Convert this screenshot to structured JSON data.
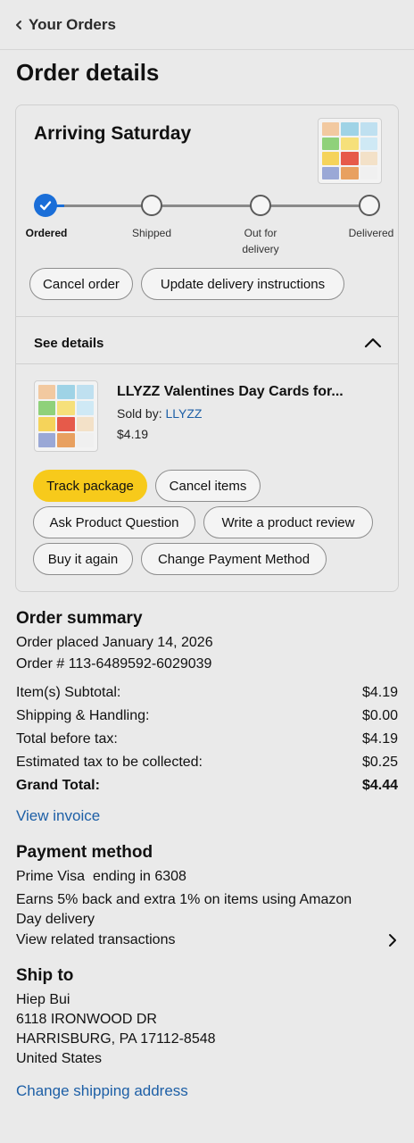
{
  "topbar": {
    "back_label": "Your Orders"
  },
  "page_title": "Order details",
  "shipment": {
    "arriving": "Arriving Saturday",
    "steps": [
      "Ordered",
      "Shipped",
      "Out for\ndelivery",
      "Delivered"
    ],
    "current_step": 0,
    "actions": {
      "cancel_order": "Cancel order",
      "update_instructions": "Update delivery instructions"
    },
    "see_details": "See details",
    "accent_color": "#1a6ed8"
  },
  "item": {
    "title": "LLYZZ Valentines Day Cards for...",
    "sold_by_label": "Sold by: ",
    "seller": "LLYZZ",
    "price": "$4.19",
    "buttons": {
      "track": "Track package",
      "cancel_items": "Cancel items",
      "ask_question": "Ask Product Question",
      "write_review": "Write a product review",
      "buy_again": "Buy it again",
      "change_payment": "Change Payment Method"
    },
    "track_color": "#f7ca1b"
  },
  "order_summary": {
    "heading": "Order summary",
    "placed": "Order placed January 14, 2026",
    "order_number": "Order # 113-6489592-6029039",
    "rows": [
      {
        "label": "Item(s) Subtotal:",
        "value": "$4.19"
      },
      {
        "label": "Shipping & Handling:",
        "value": "$0.00"
      },
      {
        "label": "Total before tax:",
        "value": "$4.19"
      },
      {
        "label": "Estimated tax to be collected:",
        "value": "$0.25"
      }
    ],
    "grand_total": {
      "label": "Grand Total:",
      "value": "$4.44"
    },
    "view_invoice": "View invoice"
  },
  "payment": {
    "heading": "Payment method",
    "card": "Prime Visa  ending in 6308",
    "earns": "Earns 5% back and extra 1% on items using Amazon Day delivery",
    "related": "View related transactions"
  },
  "ship_to": {
    "heading": "Ship to",
    "name": "Hiep Bui",
    "street": "6118 IRONWOOD DR",
    "city": "HARRISBURG, PA 17112-8548",
    "country": "United States",
    "change_link": "Change shipping address"
  },
  "link_color": "#1d5fa6"
}
